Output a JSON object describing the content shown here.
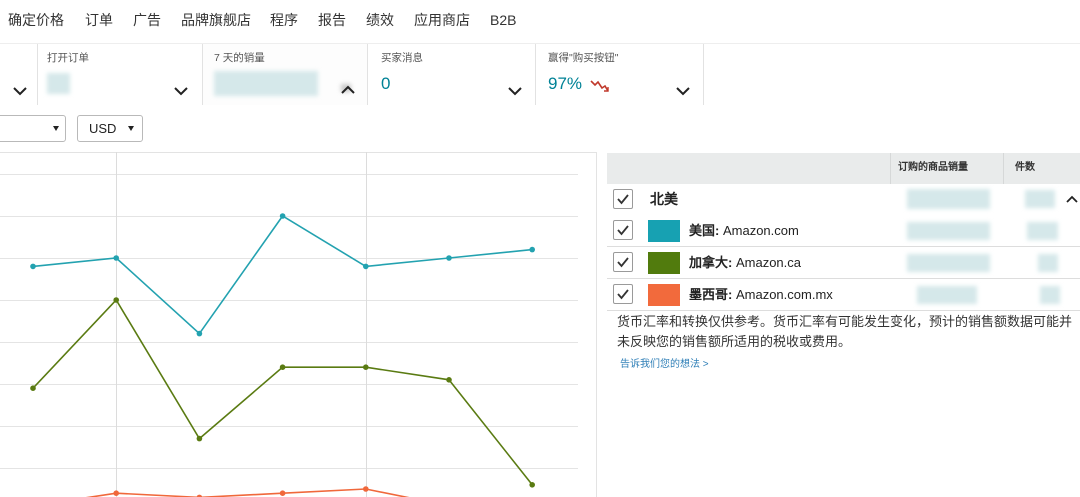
{
  "nav": {
    "items": [
      "确定价格",
      "订单",
      "广告",
      "品牌旗舰店",
      "程序",
      "报告",
      "绩效",
      "应用商店",
      "B2B"
    ]
  },
  "metrics": {
    "open_orders": {
      "label": "打开订单"
    },
    "sales_7d": {
      "label": "7 天的销量"
    },
    "buyer_messages": {
      "label": "买家消息",
      "value": "0"
    },
    "buy_box": {
      "label": "赢得\"购买按钮\"",
      "value": "97%",
      "trend_icon": "trend-down-icon",
      "trend_color": "#c0392b"
    }
  },
  "filters": {
    "currency": "USD"
  },
  "marketplaces": {
    "headers": {
      "sales": "订购的商品销量",
      "units": "件数"
    },
    "region": {
      "label": "北美",
      "checked": true,
      "expanded": true
    },
    "rows": [
      {
        "country": "美国:",
        "site": "Amazon.com",
        "checked": true,
        "color": "#17a1b2"
      },
      {
        "country": "加拿大:",
        "site": "Amazon.ca",
        "checked": true,
        "color": "#517b0d"
      },
      {
        "country": "墨西哥:",
        "site": "Amazon.com.mx",
        "checked": true,
        "color": "#f26a3c"
      }
    ]
  },
  "note": "货币汇率和转换仅供参考。货币汇率有可能发生变化，预计的销售额数据可能并未反映您的销售额所适用的税收或费用。",
  "feedback_link": "告诉我们您的想法 >",
  "colors": {
    "accent": "#008296",
    "header_bg": "#e9ebeb"
  },
  "icons": {
    "card_collapsed": "chevron-down-icon",
    "card_expanded": "chevron-up-icon",
    "region_toggle": "chevron-up-icon",
    "checkbox": "checkmark-icon",
    "select": "caret-down-icon"
  },
  "chart_data": {
    "type": "line",
    "grid": true,
    "ylim": [
      0,
      9
    ],
    "series": [
      {
        "color": "#23a2b0",
        "values": [
          6.8,
          7.0,
          5.2,
          8.0,
          6.8,
          7.0,
          7.2
        ]
      },
      {
        "color": "#5a7b12",
        "values": [
          3.9,
          6.0,
          2.7,
          4.4,
          4.4,
          4.1,
          1.6
        ]
      },
      {
        "color": "#f0683b",
        "values": [
          1.1,
          1.4,
          1.3,
          1.4,
          1.5,
          1.1,
          0.9
        ]
      }
    ]
  }
}
